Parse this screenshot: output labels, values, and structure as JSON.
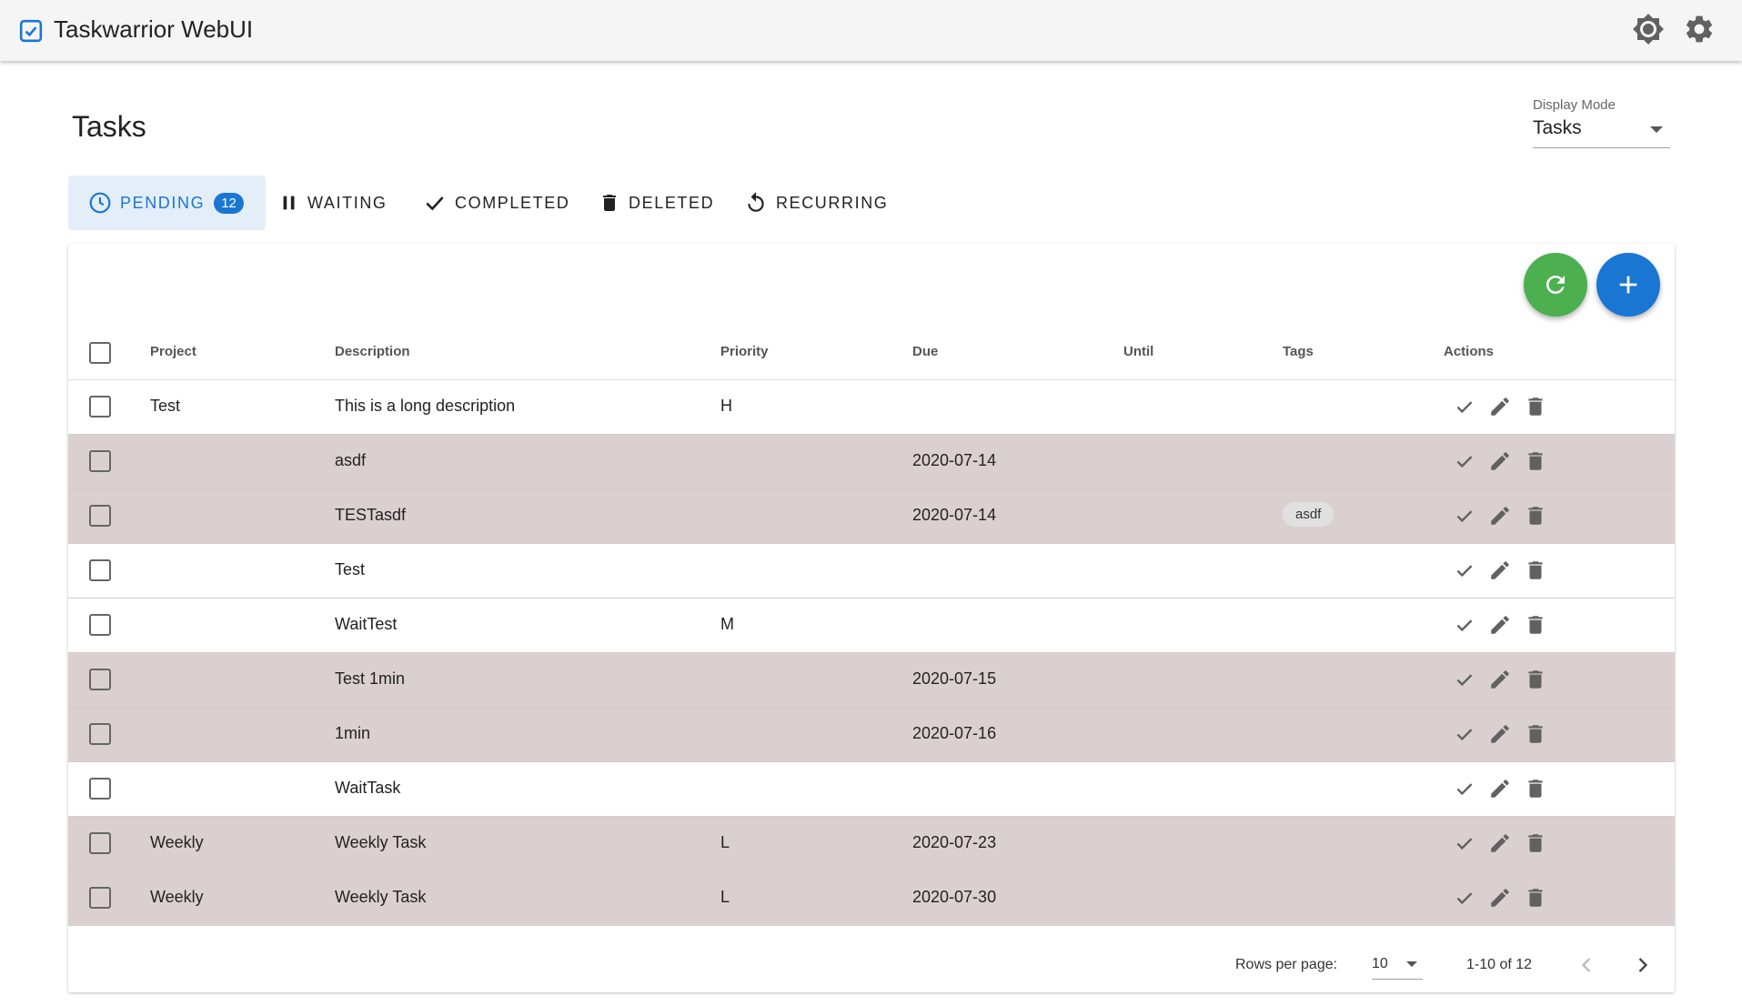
{
  "app": {
    "title": "Taskwarrior WebUI"
  },
  "page": {
    "title": "Tasks"
  },
  "display_mode": {
    "label": "Display Mode",
    "value": "Tasks"
  },
  "tabs": [
    {
      "label": "PENDING",
      "badge": "12",
      "icon": "clock-icon",
      "active": true
    },
    {
      "label": "WAITING",
      "icon": "pause-icon"
    },
    {
      "label": "COMPLETED",
      "icon": "check-icon"
    },
    {
      "label": "DELETED",
      "icon": "trash-icon"
    },
    {
      "label": "RECURRING",
      "icon": "recurring-icon"
    }
  ],
  "table": {
    "headers": [
      "Project",
      "Description",
      "Priority",
      "Due",
      "Until",
      "Tags",
      "Actions"
    ],
    "rows": [
      {
        "project": "Test",
        "description": "This is a long description",
        "priority": "H",
        "due": "",
        "until": "",
        "tag": "",
        "highlight": false
      },
      {
        "project": "",
        "description": "asdf",
        "priority": "",
        "due": "2020-07-14",
        "until": "",
        "tag": "",
        "highlight": true
      },
      {
        "project": "",
        "description": "TESTasdf",
        "priority": "",
        "due": "2020-07-14",
        "until": "",
        "tag": "asdf",
        "highlight": true
      },
      {
        "project": "",
        "description": "Test",
        "priority": "",
        "due": "",
        "until": "",
        "tag": "",
        "highlight": false
      },
      {
        "project": "",
        "description": "WaitTest",
        "priority": "M",
        "due": "",
        "until": "",
        "tag": "",
        "highlight": false
      },
      {
        "project": "",
        "description": "Test 1min",
        "priority": "",
        "due": "2020-07-15",
        "until": "",
        "tag": "",
        "highlight": true
      },
      {
        "project": "",
        "description": "1min",
        "priority": "",
        "due": "2020-07-16",
        "until": "",
        "tag": "",
        "highlight": true
      },
      {
        "project": "",
        "description": "WaitTask",
        "priority": "",
        "due": "",
        "until": "",
        "tag": "",
        "highlight": false
      },
      {
        "project": "Weekly",
        "description": "Weekly Task",
        "priority": "L",
        "due": "2020-07-23",
        "until": "",
        "tag": "",
        "highlight": true
      },
      {
        "project": "Weekly",
        "description": "Weekly Task",
        "priority": "L",
        "due": "2020-07-30",
        "until": "",
        "tag": "",
        "highlight": true
      }
    ]
  },
  "pagination": {
    "rows_per_page_label": "Rows per page:",
    "rows_per_page": "10",
    "range": "1-10 of 12"
  },
  "colors": {
    "primary": "#1976d2",
    "refresh": "#4caf50",
    "highlight_row": "#dbd0d0",
    "active_tab_bg": "#e3eef9"
  }
}
